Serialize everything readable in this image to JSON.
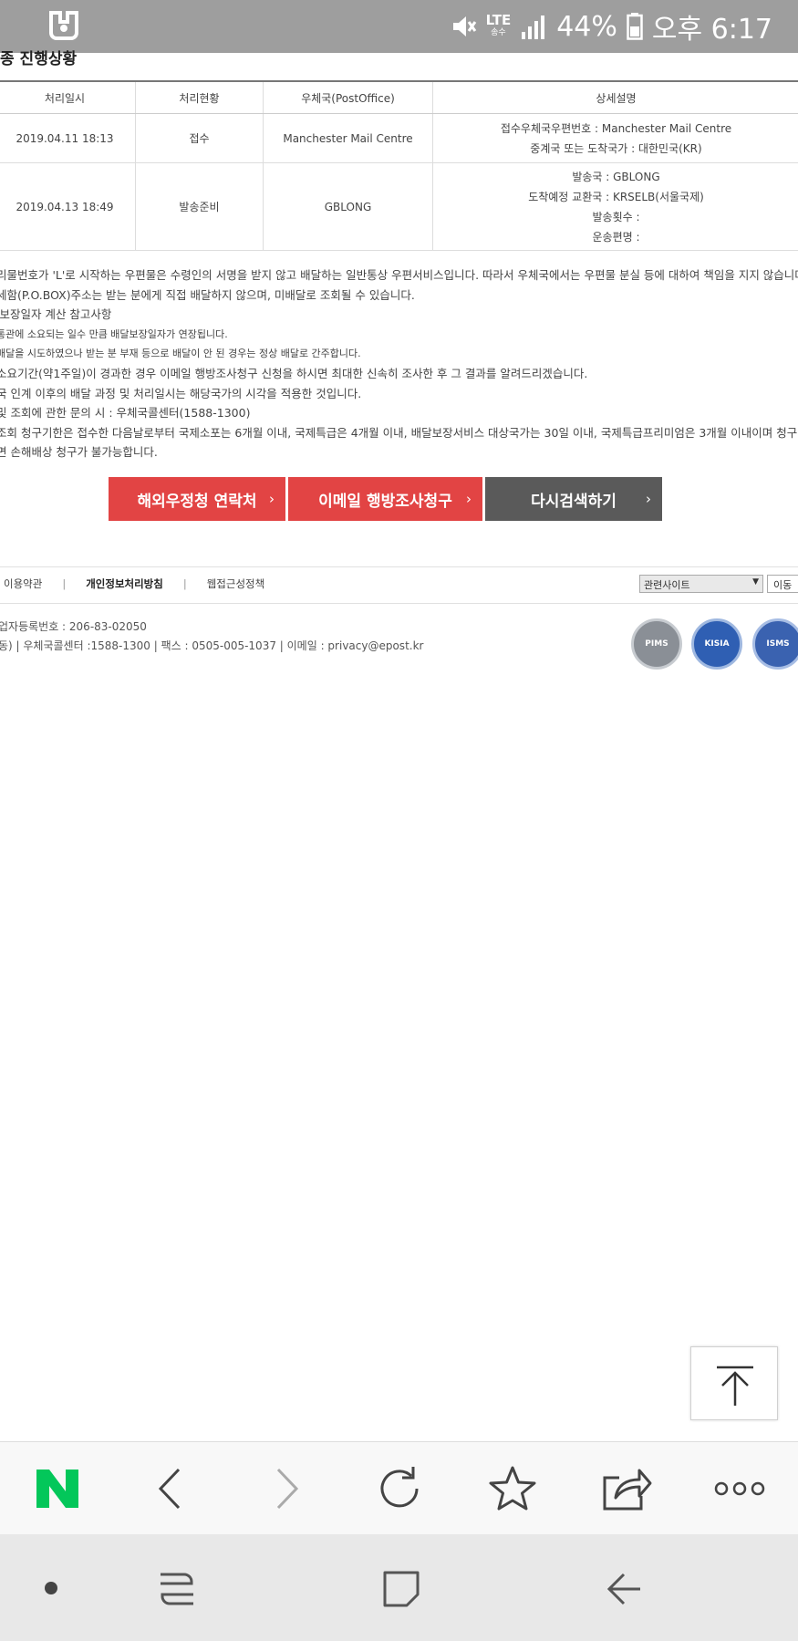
{
  "status_bar": {
    "lte_label": "LTE",
    "lte_sub": "송수",
    "battery": "44%",
    "time": "오후 6:17"
  },
  "page": {
    "title": "종 진행상황"
  },
  "table": {
    "headers": [
      "처리일시",
      "처리현황",
      "우체국(PostOffice)",
      "상세설명"
    ],
    "rows": [
      {
        "datetime": "2019.04.11 18:13",
        "status": "접수",
        "office": "Manchester Mail Centre",
        "details": [
          "접수우체국우편번호 : Manchester Mail Centre",
          "중계국 또는 도착국가 : 대한민국(KR)"
        ]
      },
      {
        "datetime": "2019.04.13 18:49",
        "status": "발송준비",
        "office": "GBLONG",
        "details": [
          "발송국 : GBLONG",
          "도착예정 교환국 : KRSELB(서울국제)",
          "발송횟수 :",
          "운송편명 :"
        ]
      }
    ]
  },
  "notes": [
    "리물번호가 'L'로 시작하는 우편물은 수령인의 서명을 받지 않고 배달하는 일반통상 우편서비스입니다. 따라서 우체국에서는 우편물 분실 등에 대하여 책임을 지지 않습니다.",
    "세함(P.O.BOX)주소는 받는 분에게 직접 배달하지 않으며, 미배달로 조회될 수 있습니다.",
    "l보장일자 계산 참고사항",
    "통관에 소요되는 일수 만큼 배달보장일자가 연장됩니다.",
    "배달을 시도하였으나 받는 분 부재 등으로 배달이 안 된 경우는 정상 배달로 간주합니다.",
    "소요기간(약1주일)이 경과한 경우 이메일 행방조사청구 신청을 하시면 최대한 신속히 조사한 후 그 결과를 알려드리겠습니다.",
    "국 인계 이후의 배달 과정 및 처리일시는 해당국가의 시각을 적용한 것입니다.",
    "및 조회에 관한 문의 시 : 우체국콜센터(1588-1300)",
    "조회 청구기한은 접수한 다음날로부터 국제소포는 6개월 이내, 국제특급은 4개월 이내, 배달보장서비스 대상국가는 30일 이내, 국제특급프리미엄은 3개월 이내이며 청구기한이",
    "면 손해배상 청구가 불가능합니다."
  ],
  "buttons": {
    "contact": "해외우정청 연락처",
    "email_claim": "이메일 행방조사청구",
    "search_again": "다시검색하기",
    "chevron": "›"
  },
  "footer": {
    "links": [
      "이용약관",
      "개인정보처리방침",
      "웹접근성정책"
    ],
    "separator": "|",
    "related_select": "관련사이트",
    "go_button": "이동",
    "info_line1": "업자등록번호 : 206-83-02050",
    "info_line2": "동)   |   우체국콜센터 :1588-1300   |   팩스 : 0505-005-1037   |   이메일 : privacy@epost.kr",
    "badges": [
      "PIMS",
      "KISIA",
      "ISMS"
    ]
  },
  "colors": {
    "status_bar": "#9e9e9e",
    "red_button": "#e24444",
    "gray_button": "#5a5a5a",
    "naver_green": "#03c75a"
  }
}
